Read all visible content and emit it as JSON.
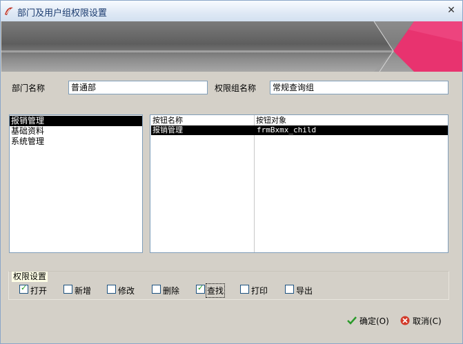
{
  "window": {
    "title": "部门及用户组权限设置",
    "close": "✕"
  },
  "form": {
    "department_label": "部门名称",
    "department_value": "普通部",
    "group_label": "权限组名称",
    "group_value": "常规查询组"
  },
  "modules": [
    "报销管理",
    "基础资料",
    "系统管理"
  ],
  "buttons_grid": {
    "headers": [
      "按钮名称",
      "按钮对象"
    ],
    "rows": [
      {
        "name": "报销管理",
        "object": "frmBxmx_child"
      }
    ]
  },
  "permissions": {
    "title": "权限设置",
    "items": [
      {
        "label": "打开",
        "checked": true
      },
      {
        "label": "新增",
        "checked": false
      },
      {
        "label": "修改",
        "checked": false
      },
      {
        "label": "删除",
        "checked": false
      },
      {
        "label": "查找",
        "checked": true
      },
      {
        "label": "打印",
        "checked": false
      },
      {
        "label": "导出",
        "checked": false
      }
    ]
  },
  "actions": {
    "ok": "确定(O)",
    "cancel": "取消(C)"
  },
  "colors": {
    "accent_pink": "#e8336f",
    "selection": "#000000",
    "ok_icon": "#2a9a2a",
    "cancel_icon": "#d23a2a"
  }
}
